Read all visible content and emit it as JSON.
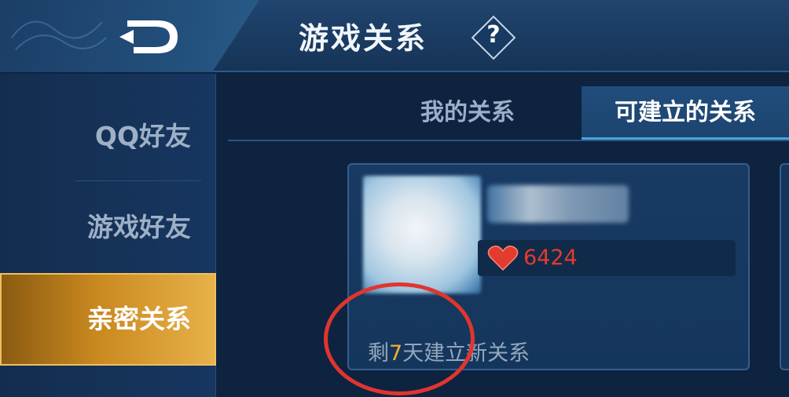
{
  "header": {
    "title": "游戏关系",
    "help_label": "?"
  },
  "sidebar": {
    "items": [
      {
        "label": "QQ好友"
      },
      {
        "label": "游戏好友"
      },
      {
        "label": "亲密关系",
        "active": true
      }
    ]
  },
  "tabs": [
    {
      "label": "我的关系"
    },
    {
      "label": "可建立的关系",
      "active": true
    }
  ],
  "card": {
    "intimacy_value": "6424",
    "remaining_prefix": "剩",
    "remaining_days": "7",
    "remaining_suffix": "天建立新关系"
  },
  "colors": {
    "accent_gold": "#e8b24a",
    "intimacy_red": "#e33b2e",
    "days_highlight": "#f0b030",
    "annotation_red": "#e0352f"
  }
}
